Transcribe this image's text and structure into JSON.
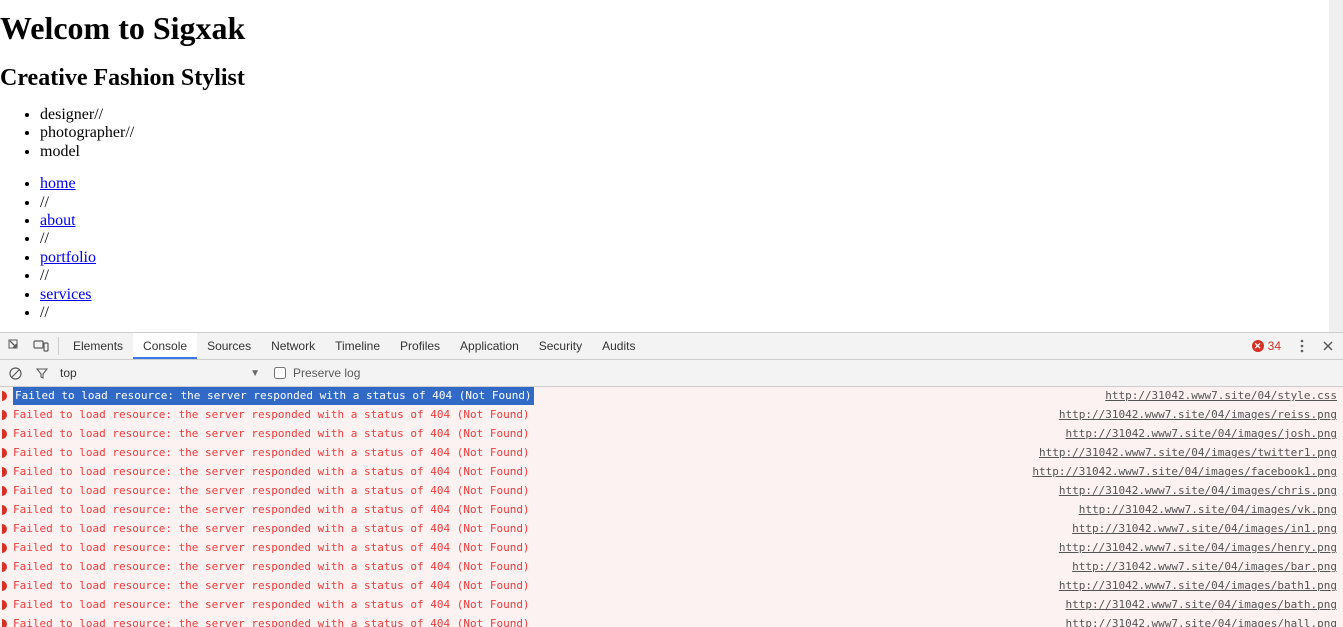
{
  "page": {
    "title": "Welcom to Sigxak",
    "subtitle": "Creative Fashion Stylist",
    "roles": [
      "designer",
      "photographer",
      "model"
    ],
    "role_sep": "//",
    "nav": [
      "home",
      "about",
      "portfolio",
      "services"
    ],
    "nav_sep": "//"
  },
  "devtools": {
    "tabs": [
      "Elements",
      "Console",
      "Sources",
      "Network",
      "Timeline",
      "Profiles",
      "Application",
      "Security",
      "Audits"
    ],
    "active_tab": "Console",
    "error_count": "34",
    "filter_context": "top",
    "preserve_log_label": "Preserve log",
    "error_message": "Failed to load resource: the server responded with a status of 404 (Not Found)",
    "rows": [
      {
        "src": "http://31042.www7.site/04/style.css",
        "selected": true
      },
      {
        "src": "http://31042.www7.site/04/images/reiss.png"
      },
      {
        "src": "http://31042.www7.site/04/images/josh.png"
      },
      {
        "src": "http://31042.www7.site/04/images/twitter1.png"
      },
      {
        "src": "http://31042.www7.site/04/images/facebook1.png"
      },
      {
        "src": "http://31042.www7.site/04/images/chris.png"
      },
      {
        "src": "http://31042.www7.site/04/images/vk.png"
      },
      {
        "src": "http://31042.www7.site/04/images/in1.png"
      },
      {
        "src": "http://31042.www7.site/04/images/henry.png"
      },
      {
        "src": "http://31042.www7.site/04/images/bar.png"
      },
      {
        "src": "http://31042.www7.site/04/images/bath1.png"
      },
      {
        "src": "http://31042.www7.site/04/images/bath.png"
      },
      {
        "src": "http://31042.www7.site/04/images/hall.png"
      }
    ]
  }
}
